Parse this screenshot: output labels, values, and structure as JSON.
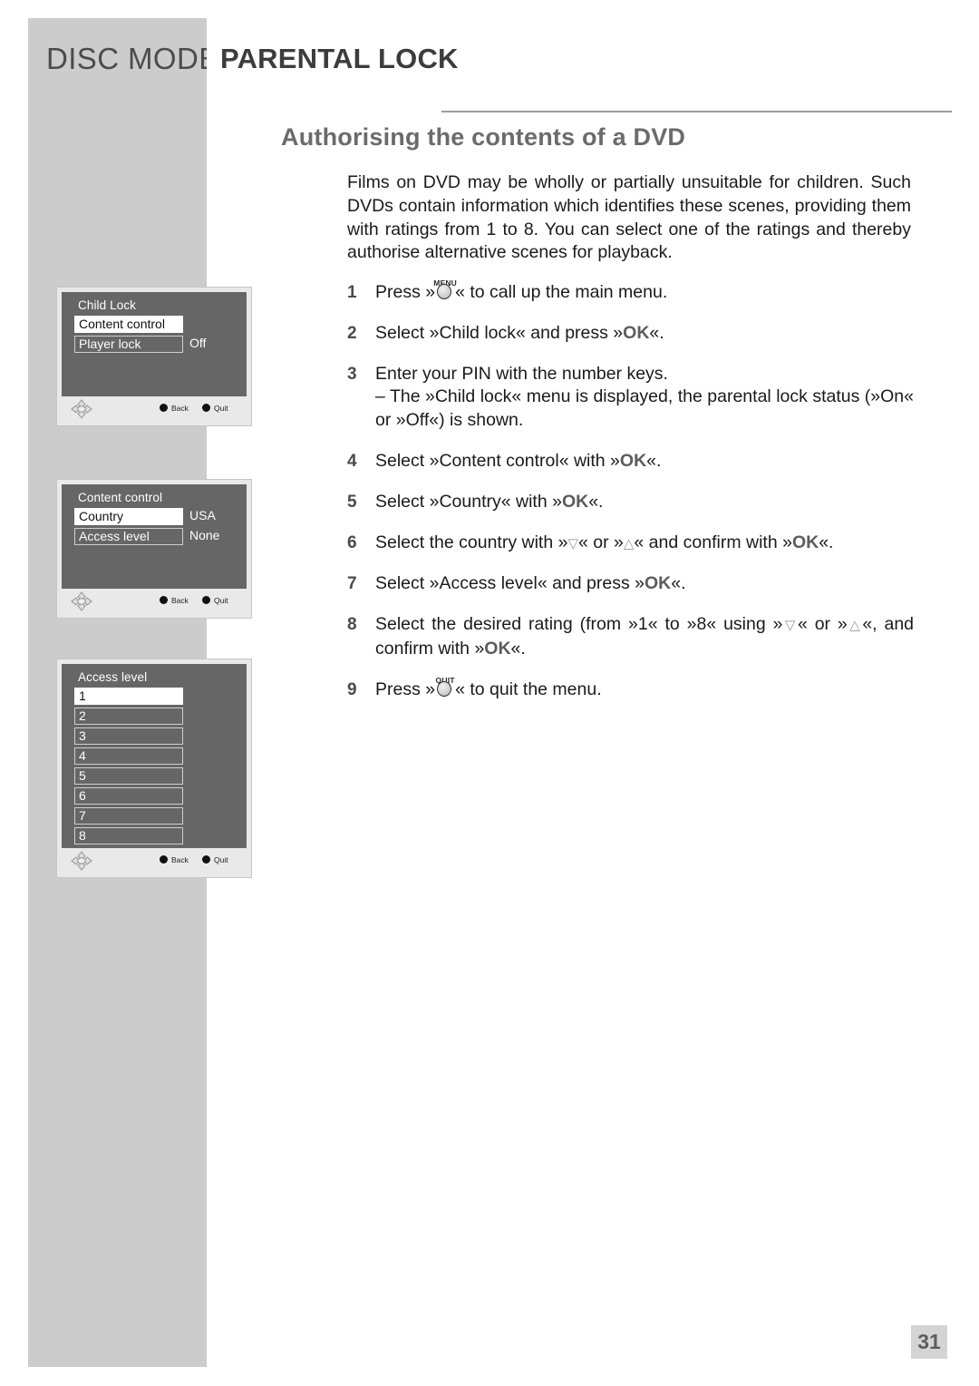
{
  "header": {
    "mode_label": "DISC MODE",
    "chapter_title": "PARENTAL LOCK"
  },
  "section": {
    "title": "Authorising the contents of a DVD",
    "intro": "Films on DVD may be wholly or partially unsuitable for children. Such DVDs contain information which identifies these scenes, providing them with ratings from 1 to 8. You can select one of the ratings and thereby authorise alternative scenes for playback."
  },
  "steps": [
    {
      "num": "1",
      "pre": "Press »",
      "button": "MENU",
      "post": "« to call up the main menu."
    },
    {
      "num": "2",
      "pre": "Select »Child lock« and press »",
      "ok": "OK",
      "post": "«."
    },
    {
      "num": "3",
      "line1": "Enter your PIN with the number keys.",
      "line2": "– The »Child lock« menu is displayed, the parental lock status (»On« or »Off«) is shown."
    },
    {
      "num": "4",
      "pre": "Select »Content control« with »",
      "ok": "OK",
      "post": "«."
    },
    {
      "num": "5",
      "pre": "Select »Country« with »",
      "ok": "OK",
      "post": "«."
    },
    {
      "num": "6",
      "pre": "Select the country with »",
      "down": "▽",
      "mid": "« or »",
      "up": "△",
      "mid2": "« and confirm with »",
      "ok": "OK",
      "post": "«."
    },
    {
      "num": "7",
      "pre": "Select »Access level« and press »",
      "ok": "OK",
      "post": "«."
    },
    {
      "num": "8",
      "pre": "Select the desired rating (from »1« to »8« using »",
      "down": "▽",
      "mid": "« or »",
      "up": "△",
      "mid2": "«, and confirm with »",
      "ok": "OK",
      "post": "«."
    },
    {
      "num": "9",
      "pre": "Press »",
      "button": "QUIT",
      "post": "« to quit the menu."
    }
  ],
  "screenshots": [
    {
      "title": "Child Lock",
      "rows": [
        {
          "label": "Content control",
          "value": "",
          "selected": true
        },
        {
          "label": "Player lock",
          "value": "Off",
          "selected": false
        }
      ],
      "more_arrow": "",
      "footer": {
        "nav_icon": "dpad-icon",
        "back": "Back",
        "quit": "Quit"
      }
    },
    {
      "title": "Content control",
      "rows": [
        {
          "label": "Country",
          "value": "USA",
          "selected": true
        },
        {
          "label": "Access level",
          "value": "None",
          "selected": false
        }
      ],
      "more_arrow": "",
      "footer": {
        "nav_icon": "dpad-icon",
        "back": "Back",
        "quit": "Quit"
      }
    },
    {
      "title": "Access level",
      "rows": [
        {
          "label": "1",
          "value": "",
          "selected": true
        },
        {
          "label": "2",
          "value": "",
          "selected": false
        },
        {
          "label": "3",
          "value": "",
          "selected": false
        },
        {
          "label": "4",
          "value": "",
          "selected": false
        },
        {
          "label": "5",
          "value": "",
          "selected": false
        },
        {
          "label": "6",
          "value": "",
          "selected": false
        },
        {
          "label": "7",
          "value": "",
          "selected": false
        },
        {
          "label": "8",
          "value": "",
          "selected": false
        }
      ],
      "more_arrow": "▼",
      "footer": {
        "nav_icon": "dpad-icon",
        "back": "Back",
        "quit": "Quit"
      }
    }
  ],
  "page_number": "31",
  "colors": {
    "band": "#cccccc",
    "osd_screen": "#666666",
    "osd_chrome": "#e9e9e9",
    "heading": "#6b6b6b"
  }
}
